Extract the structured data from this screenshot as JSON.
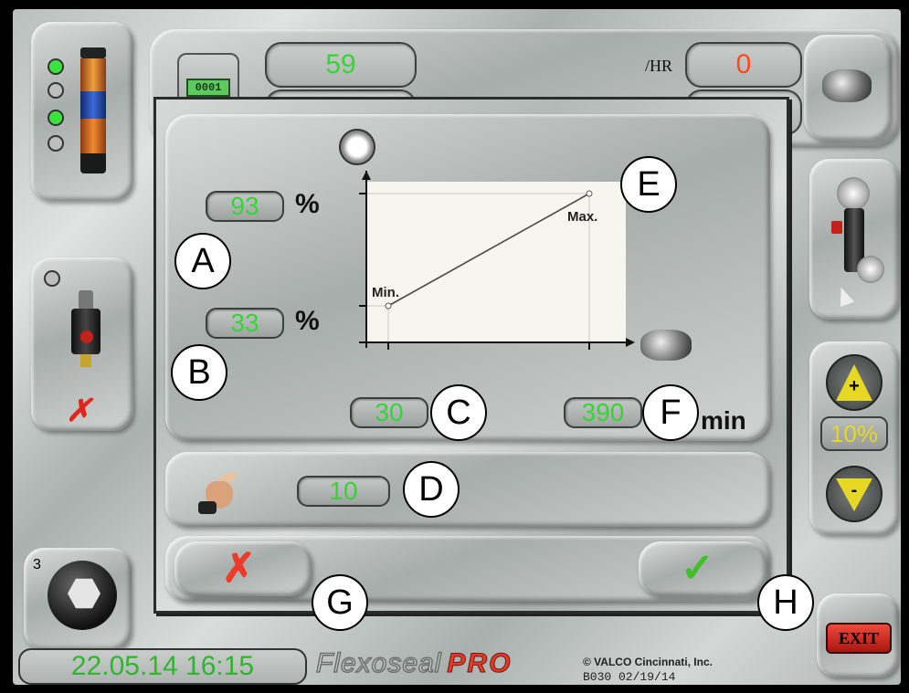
{
  "header": {
    "counter_display": "0001",
    "count_value": "59",
    "rate_unit": "/HR",
    "rate_value": "0"
  },
  "dialog": {
    "callouts": {
      "a": "A",
      "b": "B",
      "c": "C",
      "d": "D",
      "e": "E",
      "f": "F",
      "g": "G",
      "h": "H"
    },
    "max_pct": "93",
    "min_pct": "33",
    "pct_unit": "%",
    "min_speed": "30",
    "max_speed": "390",
    "speed_unit": "min",
    "graph_min_label": "Min.",
    "graph_max_label": "Max.",
    "timer_value": "10"
  },
  "right_panel": {
    "step_value": "10%",
    "plus_symbol": "+",
    "minus_symbol": "-",
    "exit_label": "EXIT"
  },
  "left_panel": {
    "wrench_badge": "3"
  },
  "footer": {
    "datetime": "22.05.14 16:15",
    "brand_main": "Flexoseal",
    "brand_pro": "PRO",
    "copyright": "© VALCO Cincinnati, Inc.",
    "version": "B030 02/19/14"
  },
  "colors": {
    "value_green": "#35d535",
    "rate_red": "#ff4a22",
    "exit_red": "#d41f1a",
    "confirm_green": "#3fbf28",
    "cancel_red": "#ee3a2a",
    "step_yellow": "#e8d826"
  }
}
